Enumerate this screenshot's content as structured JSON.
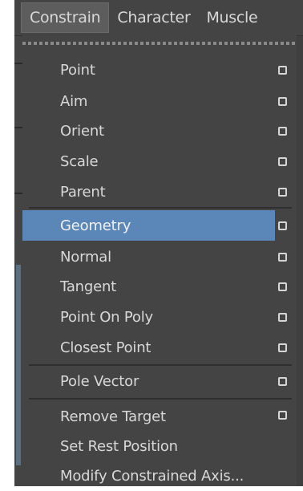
{
  "menubar": {
    "items": [
      {
        "label": "Constrain",
        "active": true
      },
      {
        "label": "Character",
        "active": false
      },
      {
        "label": "Muscle",
        "active": false
      }
    ]
  },
  "menu": {
    "items": [
      {
        "label": "Point",
        "option_box": true
      },
      {
        "label": "Aim",
        "option_box": true
      },
      {
        "label": "Orient",
        "option_box": true
      },
      {
        "label": "Scale",
        "option_box": true
      },
      {
        "label": "Parent",
        "option_box": true
      },
      {
        "label": "Geometry",
        "option_box": true,
        "highlighted": true
      },
      {
        "label": "Normal",
        "option_box": true
      },
      {
        "label": "Tangent",
        "option_box": true
      },
      {
        "label": "Point On Poly",
        "option_box": true
      },
      {
        "label": "Closest Point",
        "option_box": true
      },
      {
        "label": "Pole Vector",
        "option_box": true
      },
      {
        "label": "Remove Target",
        "option_box": true
      },
      {
        "label": "Set Rest Position",
        "option_box": false
      },
      {
        "label": "Modify Constrained Axis...",
        "option_box": false
      }
    ]
  },
  "colors": {
    "menu_bg": "#444444",
    "highlight": "#5a86b8",
    "text": "#d8d8d8"
  }
}
